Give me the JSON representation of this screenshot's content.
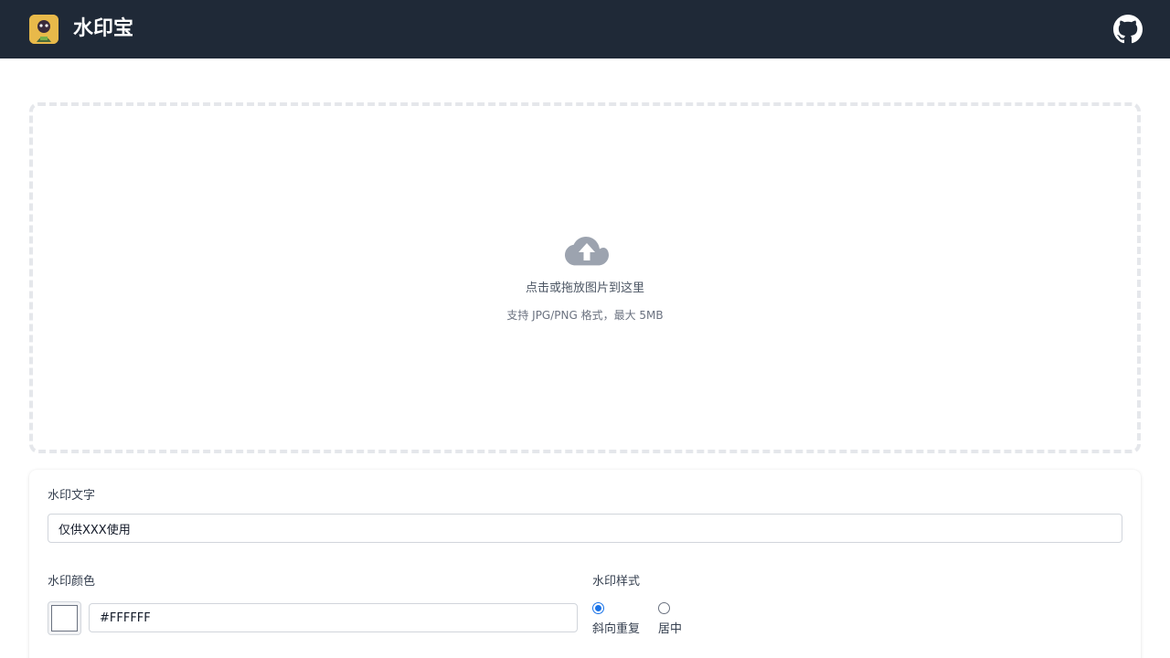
{
  "header": {
    "title": "水印宝",
    "logo_icon": "app-logo-icon",
    "github_icon": "github-icon"
  },
  "upload": {
    "icon": "cloud-upload-icon",
    "title": "点击或拖放图片到这里",
    "hint": "支持 JPG/PNG 格式，最大 5MB"
  },
  "settings": {
    "text_label": "水印文字",
    "text_value": "仅供XXX使用",
    "color_label": "水印颜色",
    "color_value": "#FFFFFF",
    "style_label": "水印样式",
    "styles": [
      {
        "label": "斜向重复",
        "selected": true
      },
      {
        "label": "居中",
        "selected": false
      }
    ]
  },
  "colors": {
    "header_bg": "#1f2937",
    "accent": "#1a73e8",
    "dropzone_border": "#e5e7eb"
  }
}
